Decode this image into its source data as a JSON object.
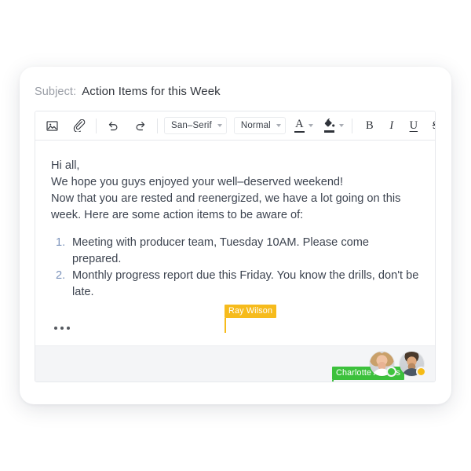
{
  "subject": {
    "label": "Subject:",
    "value": "Action Items for this Week"
  },
  "toolbar": {
    "insert_image_icon": "image-icon",
    "attach_icon": "paperclip-icon",
    "undo_icon": "undo-icon",
    "redo_icon": "redo-icon",
    "font_family": "San–Serif",
    "font_size": "Normal",
    "text_color_letter": "A",
    "text_color_swatch": "#2f333a",
    "highlight_icon": "paint-bucket-icon",
    "highlight_swatch": "#2f333a",
    "bold_label": "B",
    "italic_label": "I",
    "underline_label": "U",
    "strikethrough_label": "S"
  },
  "body": {
    "greeting": "Hi all,",
    "line2": "We hope you guys enjoyed your well–deserved weekend!",
    "line3": "Now that you are rested and reenergized, we have a lot going on this",
    "line4": "week. Here are some action items to be aware of:",
    "list": [
      {
        "marker": "1.",
        "text": "Meeting with producer team, Tuesday 10AM. Please come prepared."
      },
      {
        "marker": "2.",
        "text": "Monthly progress report due this Friday. You know the drills, don't be late."
      }
    ]
  },
  "collaborators": [
    {
      "name": "Ray Wilson",
      "color": "#f6bb1c"
    },
    {
      "name": "Charlotte Adams",
      "color": "#3cc13c"
    }
  ],
  "more_button": {
    "label": "More options",
    "icon": "ellipsis-icon"
  },
  "presence": [
    {
      "name": "Ray Wilson",
      "status": "online",
      "status_color": "#3fc43f"
    },
    {
      "name": "Charlotte Adams",
      "status": "away",
      "status_color": "#f5bb16"
    }
  ]
}
